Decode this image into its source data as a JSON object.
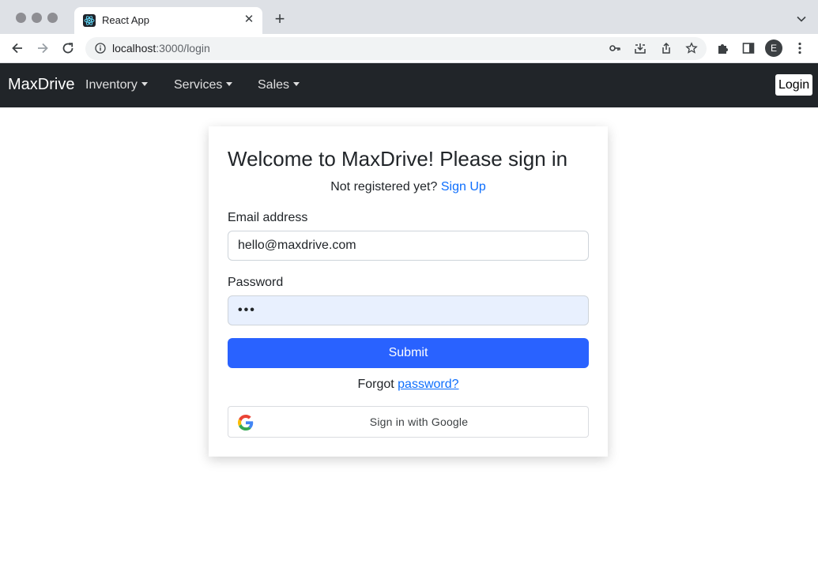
{
  "browser": {
    "tab_title": "React App",
    "tab_close_glyph": "✕",
    "new_tab_glyph": "+",
    "url_host": "localhost",
    "url_path": ":3000/login",
    "profile_initial": "E"
  },
  "navbar": {
    "brand": "MaxDrive",
    "items": [
      {
        "label": "Inventory"
      },
      {
        "label": "Services"
      },
      {
        "label": "Sales"
      }
    ],
    "login_label": "Login"
  },
  "login": {
    "title": "Welcome to MaxDrive! Please sign in",
    "register_prompt": "Not registered yet?",
    "signup_link": "Sign Up",
    "email_label": "Email address",
    "email_value": "hello@maxdrive.com",
    "password_label": "Password",
    "password_value": "•••",
    "submit_label": "Submit",
    "forgot_prefix": "Forgot",
    "forgot_link": "password?",
    "google_label": "Sign in with Google"
  },
  "colors": {
    "navbar_bg": "#212529",
    "primary": "#2962ff",
    "link": "#0d6efd",
    "autofill_bg": "#e8f0fe"
  },
  "icons": [
    "back-arrow-icon",
    "forward-arrow-icon",
    "reload-icon",
    "info-icon",
    "key-icon",
    "install-icon",
    "share-icon",
    "star-icon",
    "extensions-icon",
    "side-panel-icon",
    "kebab-menu-icon",
    "google-logo-icon"
  ]
}
